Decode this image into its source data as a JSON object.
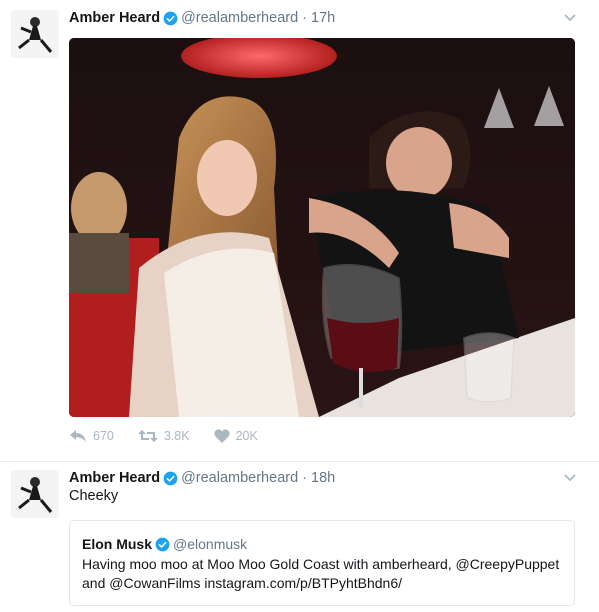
{
  "tweets": [
    {
      "author_name": "Amber Heard",
      "handle": "@realamberheard",
      "separator": "·",
      "time": "17h",
      "stats": {
        "replies": "670",
        "retweets": "3.8K",
        "likes": "20K"
      }
    },
    {
      "author_name": "Amber Heard",
      "handle": "@realamberheard",
      "separator": "·",
      "time": "18h",
      "text": "Cheeky",
      "quote": {
        "author_name": "Elon Musk",
        "handle": "@elonmusk",
        "text": "Having moo moo at Moo Moo Gold Coast with amberheard, @CreepyPuppet and @CowanFilms instagram.com/p/BTPyhtBhdn6/"
      }
    }
  ],
  "icons": {
    "verified": "verified-badge-icon",
    "caret": "chevron-down-icon",
    "reply": "reply-icon",
    "retweet": "retweet-icon",
    "like": "heart-icon"
  },
  "colors": {
    "verified": "#1da1f2",
    "meta": "#657786",
    "action": "#aab8c2"
  }
}
